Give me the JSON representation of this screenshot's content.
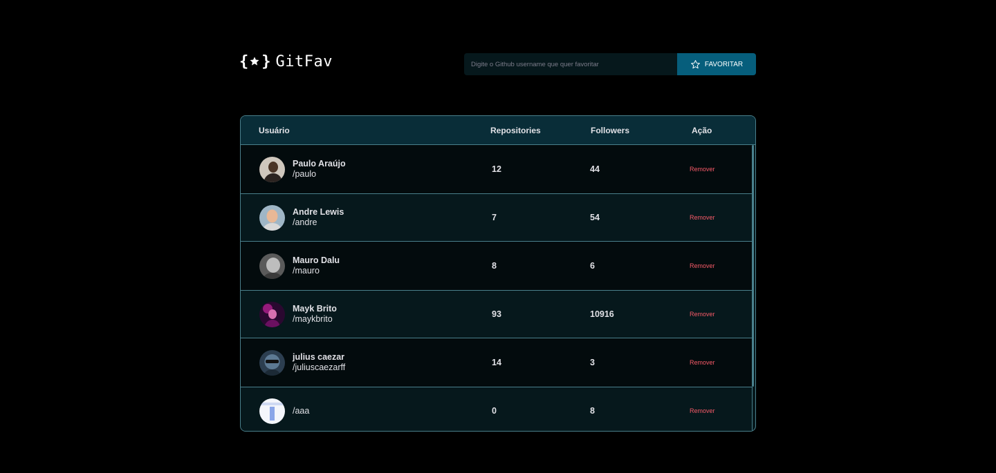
{
  "app": {
    "logo_text": "GitFav"
  },
  "search": {
    "placeholder": "Digite o Github username que quer favoritar",
    "button_label": "FAVORITAR"
  },
  "table": {
    "headers": {
      "user": "Usuário",
      "repositories": "Repositories",
      "followers": "Followers",
      "action": "Ação"
    },
    "remove_label": "Remover",
    "rows": [
      {
        "name": "Paulo Araújo",
        "login": "/paulo",
        "repositories": "12",
        "followers": "44"
      },
      {
        "name": "Andre Lewis",
        "login": "/andre",
        "repositories": "7",
        "followers": "54"
      },
      {
        "name": "Mauro Dalu",
        "login": "/mauro",
        "repositories": "8",
        "followers": "6"
      },
      {
        "name": "Mayk Brito",
        "login": "/maykbrito",
        "repositories": "93",
        "followers": "10916"
      },
      {
        "name": "julius caezar",
        "login": "/juliuscaezarff",
        "repositories": "14",
        "followers": "3"
      },
      {
        "name": "",
        "login": "/aaa",
        "repositories": "0",
        "followers": "8"
      }
    ]
  },
  "colors": {
    "background": "#000000",
    "table_header": "#092D38",
    "accent_button": "#065E7C",
    "remove_text": "#F75A68",
    "border": "#4A808C"
  }
}
